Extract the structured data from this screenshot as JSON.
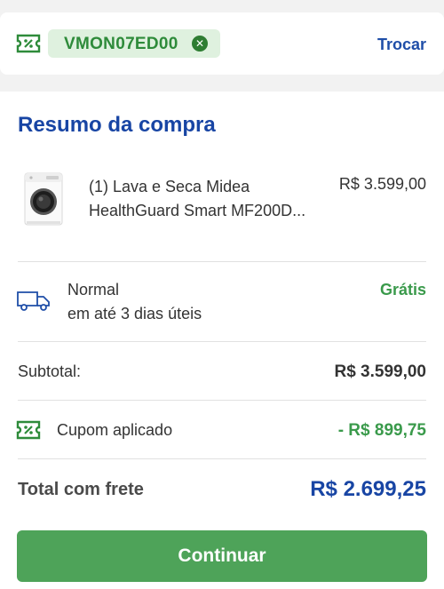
{
  "coupon": {
    "code": "VMON07ED00",
    "change_label": "Trocar"
  },
  "summary": {
    "title": "Resumo da compra",
    "product": {
      "name_line1": "(1) Lava e Seca Midea",
      "name_line2": "HealthGuard Smart MF200D...",
      "price": "R$ 3.599,00"
    },
    "shipping": {
      "method": "Normal",
      "eta": "em até 3 dias úteis",
      "price": "Grátis"
    },
    "subtotal": {
      "label": "Subtotal:",
      "value": "R$ 3.599,00"
    },
    "coupon_applied": {
      "label": "Cupom aplicado",
      "value": "- R$ 899,75"
    },
    "total": {
      "label": "Total com frete",
      "value": "R$ 2.699,25"
    },
    "continue_label": "Continuar"
  },
  "icons": {
    "coupon": "coupon-icon",
    "remove": "close-circle-icon",
    "product": "washing-machine-image",
    "shipping": "truck-icon"
  },
  "colors": {
    "brand_blue": "#1845a4",
    "success_green": "#3a9a4b",
    "button_green": "#4ea359",
    "chip_bg": "#dff1df"
  }
}
